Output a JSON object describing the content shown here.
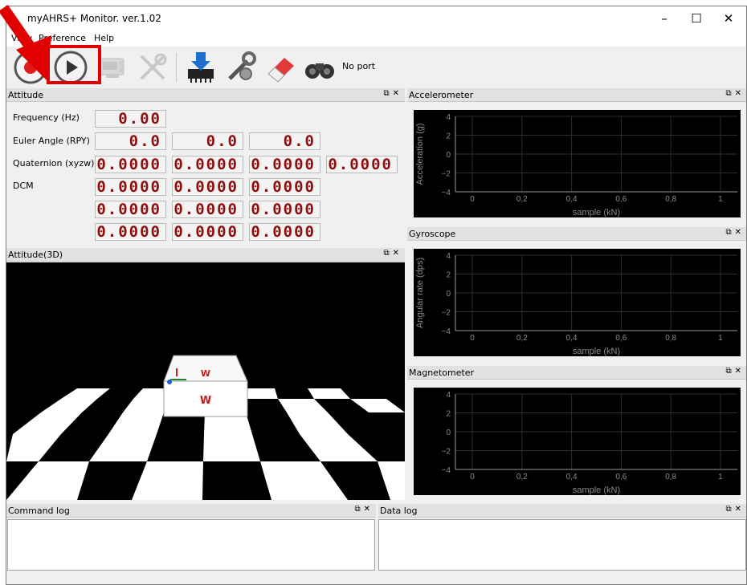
{
  "window": {
    "title": "myAHRS+ Monitor. ver.1.02"
  },
  "menu": [
    "View",
    "Preference",
    "Help"
  ],
  "toolbar": {
    "port_status": "No port"
  },
  "attitude": {
    "title": "Attitude",
    "frequency_label": "Frequency (Hz)",
    "frequency": "0.00",
    "euler_label": "Euler Angle (RPY)",
    "euler": [
      "0.0",
      "0.0",
      "0.0"
    ],
    "quaternion_label": "Quaternion (xyzw)",
    "quaternion": [
      "0.0000",
      "0.0000",
      "0.0000",
      "0.0000"
    ],
    "dcm_label": "DCM",
    "dcm": [
      "0.0000",
      "0.0000",
      "0.0000",
      "0.0000",
      "0.0000",
      "0.0000",
      "0.0000",
      "0.0000",
      "0.0000"
    ]
  },
  "attitude3d": {
    "title": "Attitude(3D)"
  },
  "panels": {
    "accelerometer": "Accelerometer",
    "gyroscope": "Gyroscope",
    "magnetometer": "Magnetometer",
    "command_log": "Command log",
    "data_log": "Data log"
  },
  "chart_data": [
    {
      "type": "line",
      "title": "Accelerometer",
      "xlabel": "sample (kN)",
      "ylabel": "Acceleration (g)",
      "xlim": [
        0,
        1
      ],
      "ylim": [
        -4,
        4
      ],
      "x_ticks": [
        "0",
        "0,2",
        "0,4",
        "0,6",
        "0,8",
        "1"
      ],
      "y_ticks": [
        "4",
        "2",
        "0",
        "−2",
        "−4"
      ],
      "series": []
    },
    {
      "type": "line",
      "title": "Gyroscope",
      "xlabel": "sample (kN)",
      "ylabel": "Angular rate (dps)",
      "xlim": [
        0,
        1
      ],
      "ylim": [
        -4,
        4
      ],
      "x_ticks": [
        "0",
        "0,2",
        "0,4",
        "0,6",
        "0,8",
        "1"
      ],
      "y_ticks": [
        "4",
        "2",
        "0",
        "−2",
        "−4"
      ],
      "series": []
    },
    {
      "type": "line",
      "title": "Magnetometer",
      "xlabel": "sample (kN)",
      "ylabel": "",
      "xlim": [
        0,
        1
      ],
      "ylim": [
        -4,
        4
      ],
      "x_ticks": [
        "0",
        "0,2",
        "0,4",
        "0,6",
        "0,8",
        "1"
      ],
      "y_ticks": [
        "4",
        "2",
        "0",
        "−2",
        "−4"
      ],
      "series": []
    }
  ],
  "colors": {
    "annotation_red": "#e00000",
    "segment_red": "#8e0e0e",
    "chart_bg": "#000000"
  }
}
